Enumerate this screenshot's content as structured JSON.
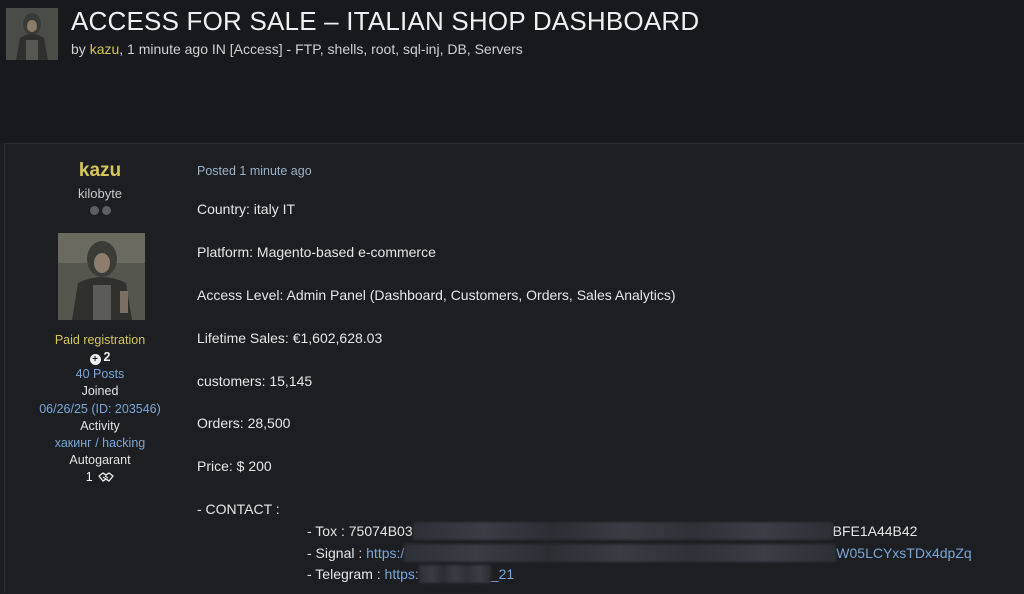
{
  "header": {
    "title": "ACCESS FOR SALE – ITALIAN SHOP DASHBOARD",
    "meta_by": "by ",
    "meta_author": "kazu",
    "meta_rest": ", 1 minute ago IN [Access] - FTP, shells, root, sql-inj, DB, Servers"
  },
  "author": {
    "username": "kazu",
    "rank": "kilobyte",
    "group": "Paid registration",
    "reputation": "2",
    "posts": "40 Posts",
    "joined_label": "Joined",
    "joined_date": "06/26/25 (ID: 203546)",
    "activity_label": "Activity",
    "activity_value": "хакинг / hacking",
    "autogarant_label": "Autogarant",
    "autogarant_value": "1"
  },
  "post": {
    "posted": "Posted 1 minute ago",
    "country": "Country: italy IT",
    "platform": "Platform: Magento-based e-commerce",
    "access_level": "Access Level: Admin Panel (Dashboard, Customers, Orders, Sales Analytics)",
    "lifetime_sales": "Lifetime Sales: €1,602,628.03",
    "customers": "customers: 15,145",
    "orders": "Orders: 28,500",
    "price": "Price: $ 200",
    "contact_label": "- CONTACT :",
    "tox_label": "- Tox : ",
    "tox_start": "75074B03",
    "tox_end": "BFE1A44B42",
    "signal_label": "- Signal : ",
    "signal_start": "https:/",
    "signal_end": "W05LCYxsTDx4dpZq",
    "telegram_label": "- Telegram : ",
    "telegram_start": "https:",
    "telegram_end": "_21"
  }
}
